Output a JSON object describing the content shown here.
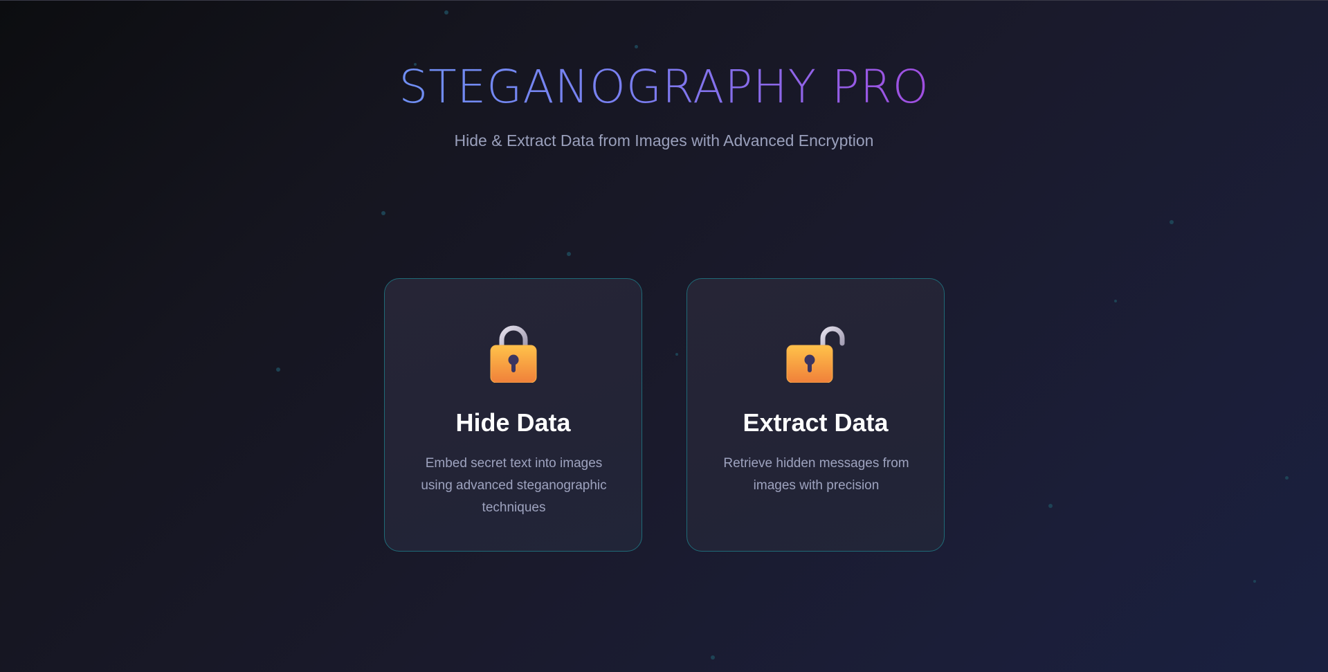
{
  "header": {
    "title": "STEGANOGRAPHY PRO",
    "subtitle": "Hide & Extract Data from Images with Advanced Encryption"
  },
  "cards": [
    {
      "icon": "locked-padlock-icon",
      "title": "Hide Data",
      "description": "Embed secret text into images using advanced steganographic techniques"
    },
    {
      "icon": "unlocked-padlock-icon",
      "title": "Extract Data",
      "description": "Retrieve hidden messages from images with precision"
    }
  ],
  "colors": {
    "title_gradient_start": "#6f8ff3",
    "title_gradient_end": "#a04ee0",
    "card_border": "#1f6b78",
    "lock_body": "#f6a33a",
    "lock_shackle": "#c9c3d6",
    "keyhole": "#3b3560"
  }
}
